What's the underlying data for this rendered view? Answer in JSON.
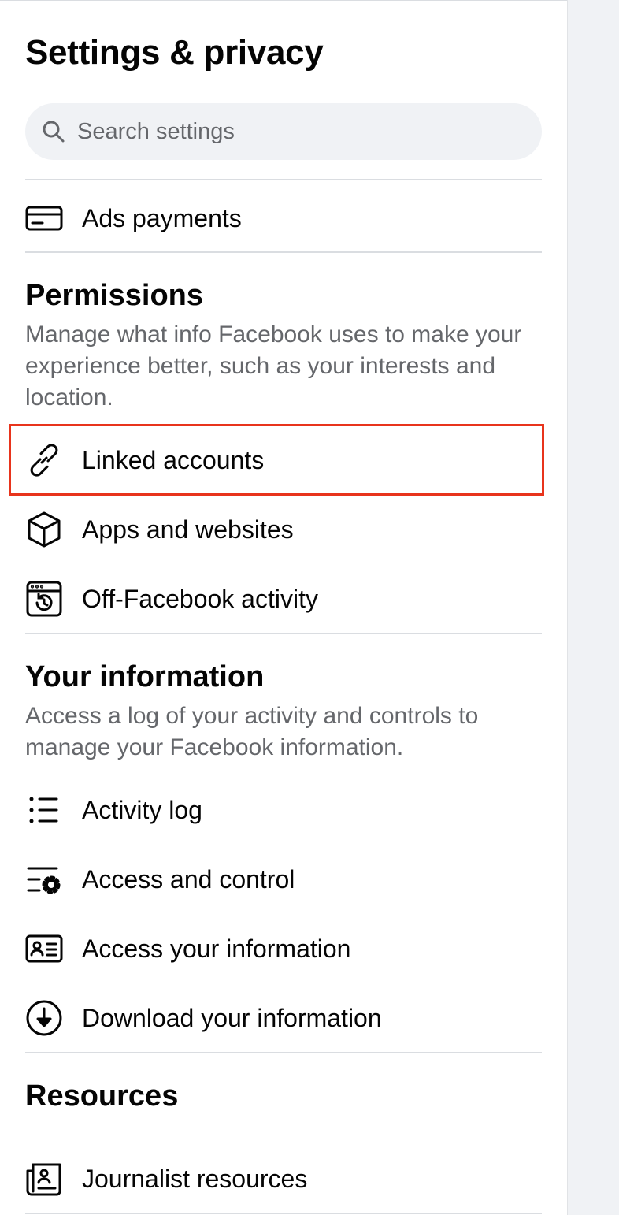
{
  "title": "Settings & privacy",
  "search": {
    "placeholder": "Search settings",
    "value": ""
  },
  "top_items": [
    {
      "label": "Ads payments",
      "icon": "credit-card-icon"
    }
  ],
  "permissions": {
    "title": "Permissions",
    "description": "Manage what info Facebook uses to make your experience better, such as your interests and location.",
    "items": [
      {
        "label": "Linked accounts",
        "icon": "link-icon"
      },
      {
        "label": "Apps and websites",
        "icon": "cube-icon"
      },
      {
        "label": "Off-Facebook activity",
        "icon": "browser-history-icon"
      }
    ]
  },
  "your_information": {
    "title": "Your information",
    "description": "Access a log of your activity and controls to manage your Facebook information.",
    "items": [
      {
        "label": "Activity log",
        "icon": "list-icon"
      },
      {
        "label": "Access and control",
        "icon": "list-gear-icon"
      },
      {
        "label": "Access your information",
        "icon": "id-card-icon"
      },
      {
        "label": "Download your information",
        "icon": "download-circle-icon"
      }
    ]
  },
  "resources": {
    "title": "Resources",
    "items": [
      {
        "label": "Journalist resources",
        "icon": "newspaper-icon"
      }
    ]
  },
  "colors": {
    "highlight": "#e8341c",
    "secondary_text": "#65676b",
    "divider": "#dadde1"
  }
}
